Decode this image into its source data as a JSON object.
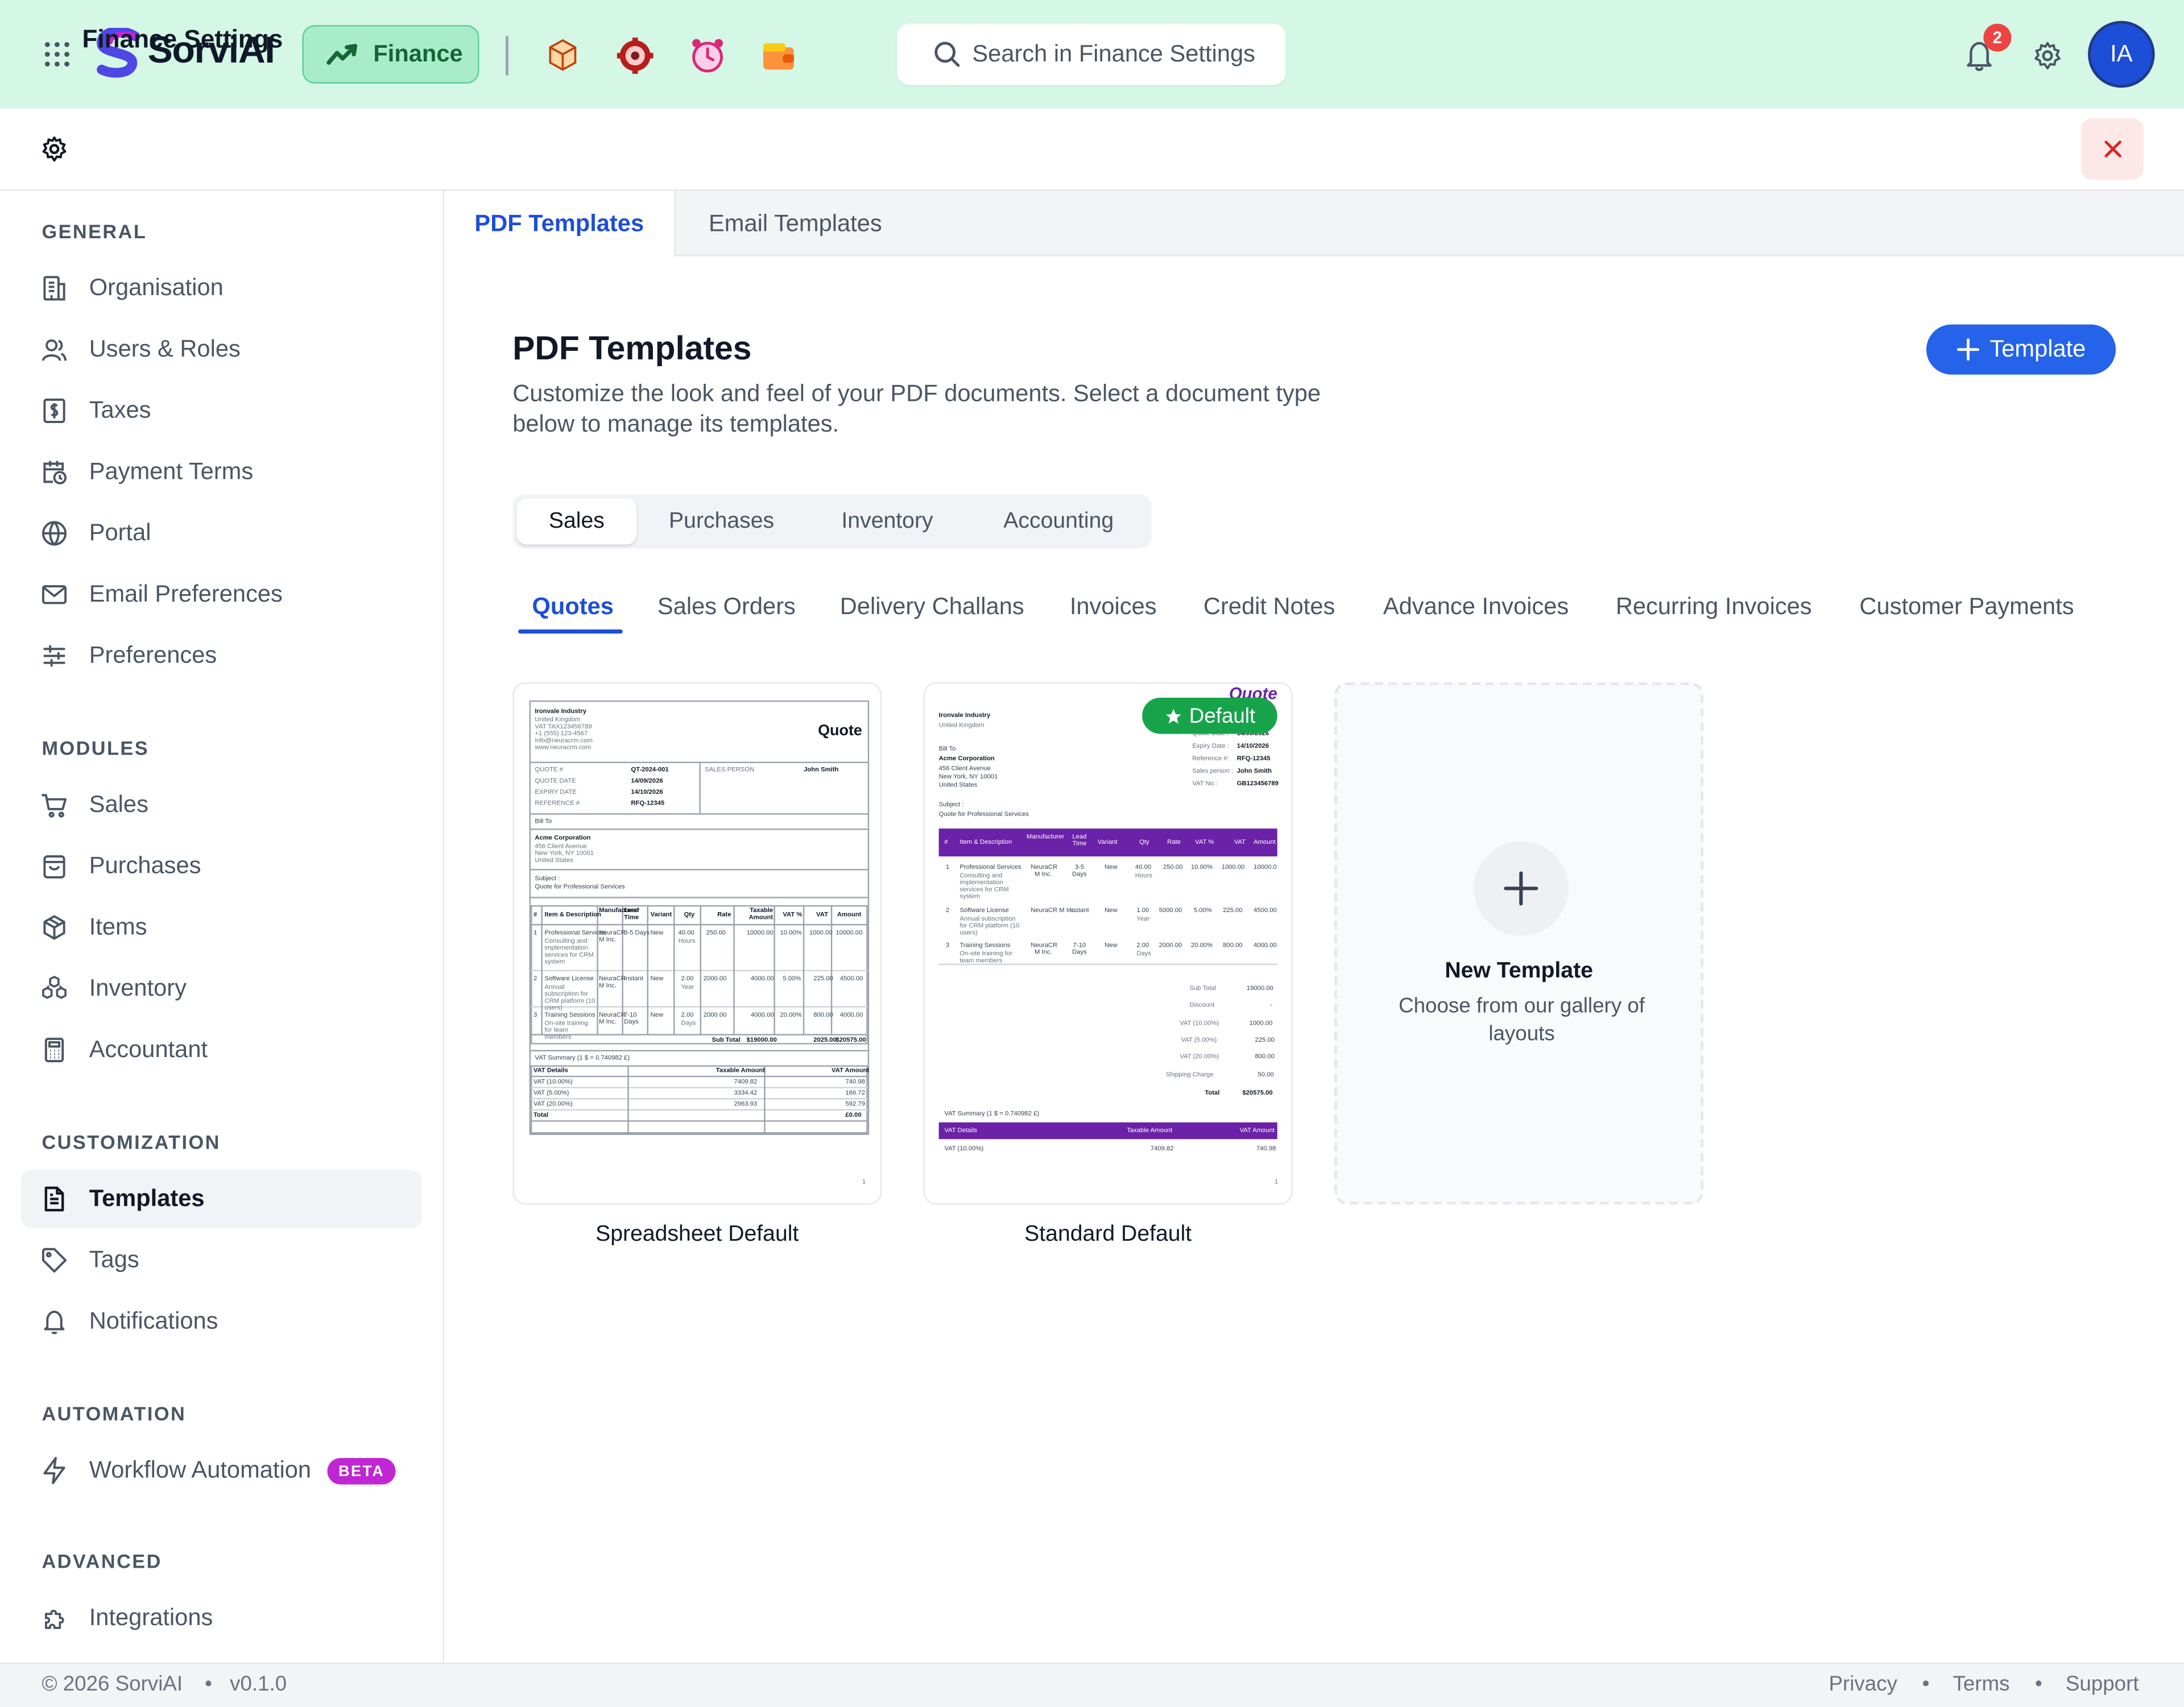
{
  "app": {
    "name": "SorviAI",
    "module": "Finance"
  },
  "search": {
    "placeholder": "Search in Finance Settings"
  },
  "notifications": {
    "count": "2"
  },
  "user": {
    "initials": "IA"
  },
  "settings": {
    "title": "Finance Settings"
  },
  "sidebar": {
    "general_title": "GENERAL",
    "general": [
      "Organisation",
      "Users & Roles",
      "Taxes",
      "Payment Terms",
      "Portal",
      "Email Preferences",
      "Preferences"
    ],
    "modules_title": "MODULES",
    "modules": [
      "Sales",
      "Purchases",
      "Items",
      "Inventory",
      "Accountant"
    ],
    "customization_title": "CUSTOMIZATION",
    "customization": [
      "Templates",
      "Tags",
      "Notifications"
    ],
    "automation_title": "AUTOMATION",
    "automation": [
      "Workflow Automation"
    ],
    "beta": "BETA",
    "advanced_title": "ADVANCED",
    "advanced": [
      "Integrations"
    ]
  },
  "tabs": [
    "PDF Templates",
    "Email Templates"
  ],
  "page": {
    "title": "PDF Templates",
    "description": "Customize the look and feel of your PDF documents. Select a document type below to manage its templates.",
    "add_button": "Template"
  },
  "categories": [
    "Sales",
    "Purchases",
    "Inventory",
    "Accounting"
  ],
  "doc_types": [
    "Quotes",
    "Sales Orders",
    "Delivery Challans",
    "Invoices",
    "Credit Notes",
    "Advance Invoices",
    "Recurring Invoices",
    "Customer Payments"
  ],
  "templates": [
    {
      "name": "Spreadsheet Default"
    },
    {
      "name": "Standard Default",
      "badge": "Default"
    }
  ],
  "new_template": {
    "title": "New Template",
    "subtitle": "Choose from our gallery of layouts"
  },
  "thumb1": {
    "company": "Ironvale Industry",
    "addr": [
      "United Kingdom",
      "VAT TAX123456789",
      "+1 (555) 123-4567",
      "info@neuracrm.com",
      "www.neuracrm.com"
    ],
    "doc_title": "Quote",
    "meta_labels": [
      "QUOTE #",
      "QUOTE DATE",
      "EXPIRY DATE",
      "REFERENCE #"
    ],
    "meta_values": [
      "QT-2024-001",
      "14/09/2026",
      "14/10/2026",
      "RFQ-12345"
    ],
    "salesperson_label": "SALES PERSON",
    "salesperson": "John Smith",
    "bill_to": "Bill To",
    "customer": "Acme Corporation",
    "cust_addr": [
      "456 Client Avenue",
      "New York, NY 10001",
      "United States"
    ],
    "subject_label": "Subject :",
    "subject": "Quote for Professional Services",
    "headers": [
      "#",
      "Item & Description",
      "Manufacturer",
      "Lead Time",
      "Variant",
      "Qty",
      "Rate",
      "Taxable Amount",
      "VAT %",
      "VAT",
      "Amount"
    ],
    "rows": [
      [
        "1",
        "Professional Services",
        "NeuraCR M Inc.",
        "3-5 Days",
        "New",
        "40.00",
        "250.00",
        "10000.00",
        "10.00%",
        "1000.00",
        "10000.00"
      ],
      [
        "2",
        "Software License",
        "NeuraCR M Inc.",
        "Instant",
        "New",
        "2.00",
        "2000.00",
        "4000.00",
        "5.00%",
        "225.00",
        "4500.00"
      ],
      [
        "3",
        "Training Sessions",
        "NeuraCR M Inc.",
        "7-10 Days",
        "New",
        "2.00",
        "2000.00",
        "4000.00",
        "20.00%",
        "800.00",
        "4000.00"
      ]
    ],
    "row_notes": [
      "Consulting and implementation services for CRM system",
      "Annual subscription for CRM platform (10 users)",
      "On-site training for team members"
    ],
    "row_units": [
      "Hours",
      "Year",
      "Days"
    ],
    "subtotal_label": "Sub Total",
    "subtotal": [
      "$19000.00",
      "2025.00",
      "$20575.00"
    ],
    "vat_summary": "VAT Summary (1 $ = 0.740982 £)",
    "vat_headers": [
      "VAT Details",
      "Taxable Amount",
      "VAT Amount"
    ],
    "vat_rows": [
      [
        "VAT (10.00%)",
        "7409.82",
        "740.98"
      ],
      [
        "VAT (5.00%)",
        "3334.42",
        "166.72"
      ],
      [
        "VAT (20.00%)",
        "2963.93",
        "592.79"
      ],
      [
        "Total",
        "",
        "£0.00"
      ]
    ],
    "page_no": "1"
  },
  "thumb2": {
    "company": "Ironvale Industry",
    "addr": [
      "United Kingdom"
    ],
    "doc_title": "Quote",
    "bill_to": "Bill To",
    "customer": "Acme Corporation",
    "cust_addr": [
      "456 Client Avenue",
      "New York, NY 10001",
      "United States"
    ],
    "subject_label": "Subject :",
    "subject": "Quote for Professional Services",
    "meta_labels": [
      "Quote #:",
      "Quote Date :",
      "Expiry Date :",
      "Reference #:",
      "Sales person :",
      "VAT No.:"
    ],
    "meta_values": [
      "QT-2024-001",
      "14/09/2026",
      "14/10/2026",
      "RFQ-12345",
      "John Smith",
      "GB123456789"
    ],
    "headers": [
      "#",
      "Item & Description",
      "Manufacturer",
      "Lead Time",
      "Variant",
      "Qty",
      "Rate",
      "VAT %",
      "VAT",
      "Amount"
    ],
    "rows": [
      [
        "1",
        "Professional Services",
        "NeuraCR M Inc.",
        "3-5 Days",
        "New",
        "40.00",
        "250.00",
        "10.00%",
        "1000.00",
        "10000.0"
      ],
      [
        "2",
        "Software License",
        "NeuraCR M Inc.",
        "Instant",
        "New",
        "1.00",
        "5000.00",
        "5.00%",
        "225.00",
        "4500.00"
      ],
      [
        "3",
        "Training Sessions",
        "NeuraCR M Inc.",
        "7-10 Days",
        "New",
        "2.00",
        "2000.00",
        "20.00%",
        "800.00",
        "4000.00"
      ]
    ],
    "row_notes": [
      "Consulting and implementation services for CRM system",
      "Annual subscription for CRM platform (10 users)",
      "On-site training for team members"
    ],
    "row_units": [
      "Hours",
      "Year",
      "Days"
    ],
    "totals": [
      [
        "Sub Total",
        "19000.00"
      ],
      [
        "Discount",
        "-"
      ],
      [
        "VAT (10.00%)",
        "1000.00"
      ],
      [
        "VAT (5.00%)",
        "225.00"
      ],
      [
        "VAT (20.00%)",
        "800.00"
      ],
      [
        "Shipping Charge",
        "50.00"
      ],
      [
        "Total",
        "$20575.00"
      ]
    ],
    "vat_summary": "VAT Summary (1 $ = 0.740982 £)",
    "vat_headers": [
      "VAT Details",
      "Taxable Amount",
      "VAT Amount"
    ],
    "vat_rows": [
      [
        "VAT (10.00%)",
        "7409.82",
        "740.98"
      ]
    ],
    "page_no": "1"
  },
  "footer": {
    "copyright": "© 2026 SorviAI",
    "version": "v0.1.0",
    "links": [
      "Privacy",
      "Terms",
      "Support"
    ]
  },
  "colors": {
    "topbar": "#d4f7e6",
    "primary": "#2563eb",
    "accent_purple": "#6b21a8",
    "success": "#16a34a",
    "beta": "#c026d3"
  }
}
